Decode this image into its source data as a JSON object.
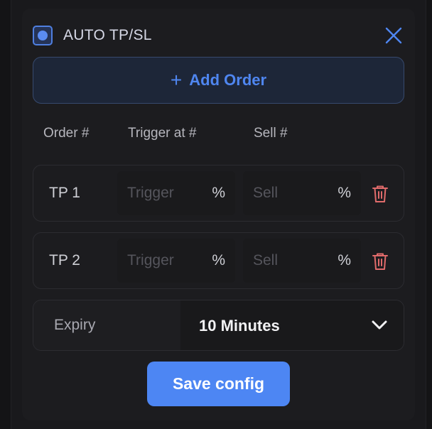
{
  "header": {
    "title": "AUTO TP/SL",
    "checkbox_checked": true,
    "close_icon": "close-icon",
    "accent_color": "#5b8cf2"
  },
  "add_order": {
    "icon": "plus-icon",
    "label": "Add Order"
  },
  "columns": [
    "Order #",
    "Trigger at #",
    "Sell #"
  ],
  "orders": [
    {
      "label": "TP 1",
      "trigger_value": "",
      "trigger_placeholder": "Trigger",
      "trigger_unit": "%",
      "sell_value": "",
      "sell_placeholder": "Sell",
      "sell_unit": "%",
      "delete_icon": "trash-icon"
    },
    {
      "label": "TP 2",
      "trigger_value": "",
      "trigger_placeholder": "Trigger",
      "trigger_unit": "%",
      "sell_value": "",
      "sell_placeholder": "Sell",
      "sell_unit": "%",
      "delete_icon": "trash-icon"
    }
  ],
  "expiry": {
    "label": "Expiry",
    "value": "10 Minutes",
    "icon": "chevron-down-icon"
  },
  "save_button": {
    "label": "Save config",
    "color": "#4d86f3"
  },
  "delete_color": "#e06b6b"
}
